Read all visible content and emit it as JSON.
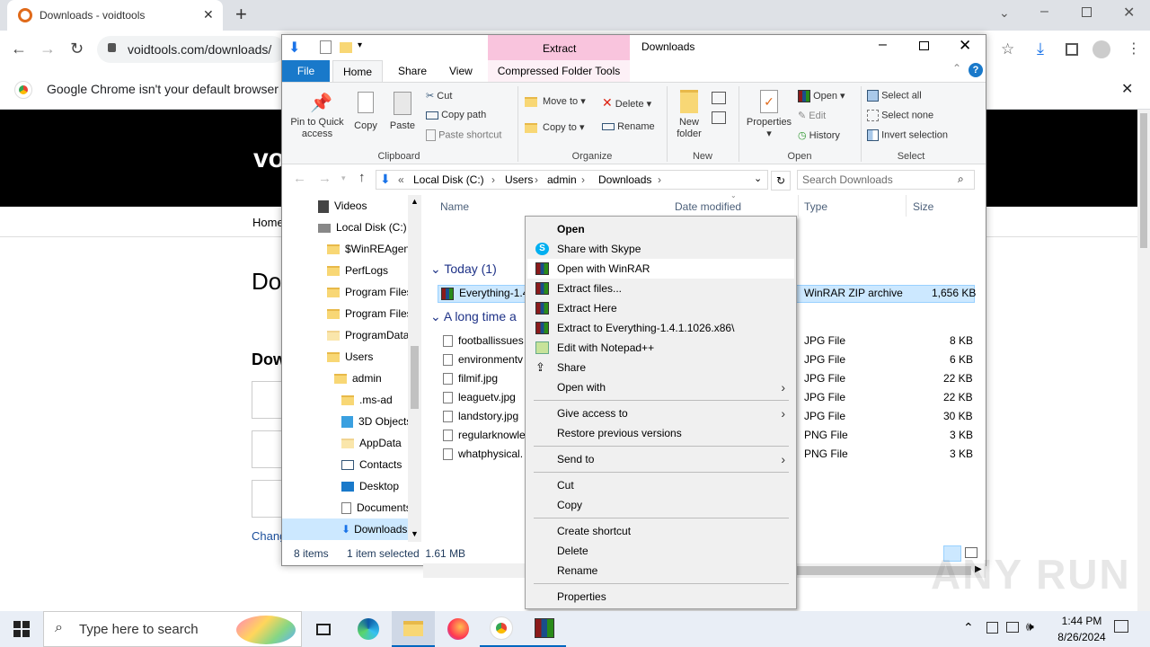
{
  "chrome": {
    "tab_title": "Downloads - voidtools",
    "new_tab": "+",
    "url": "voidtools.com/downloads/",
    "infobar_text": "Google Chrome isn't your default browser",
    "infobar_close": "✕"
  },
  "site": {
    "logo_partial": "vo",
    "nav_home": "Home",
    "heading_partial": "Do",
    "sub_heading_partial": "Dow",
    "link_partial": "Chang"
  },
  "explorer": {
    "title": "Downloads",
    "context_tab": "Extract",
    "context_group": "Compressed Folder Tools",
    "tabs": [
      "File",
      "Home",
      "Share",
      "View"
    ],
    "clipboard": {
      "pin": "Pin to Quick access",
      "copy": "Copy",
      "paste": "Paste",
      "cut": "Cut",
      "copy_path": "Copy path",
      "paste_shortcut": "Paste shortcut",
      "label": "Clipboard"
    },
    "organize": {
      "move_to": "Move to",
      "copy_to": "Copy to",
      "delete": "Delete",
      "rename": "Rename",
      "label": "Organize"
    },
    "new": {
      "new_folder": "New folder",
      "label": "New"
    },
    "open": {
      "properties": "Properties",
      "open": "Open",
      "edit": "Edit",
      "history": "History",
      "label": "Open"
    },
    "select": {
      "select_all": "Select all",
      "select_none": "Select none",
      "invert": "Invert selection",
      "label": "Select"
    },
    "address": {
      "crumbs": [
        "Local Disk (C:)",
        "Users",
        "admin",
        "Downloads"
      ],
      "search_placeholder": "Search Downloads"
    },
    "nav": [
      {
        "label": "Videos"
      },
      {
        "label": "Local Disk (C:)"
      },
      {
        "label": "$WinREAgent"
      },
      {
        "label": "PerfLogs"
      },
      {
        "label": "Program Files"
      },
      {
        "label": "Program Files"
      },
      {
        "label": "ProgramData"
      },
      {
        "label": "Users"
      },
      {
        "label": "admin"
      },
      {
        "label": ".ms-ad"
      },
      {
        "label": "3D Objects"
      },
      {
        "label": "AppData"
      },
      {
        "label": "Contacts"
      },
      {
        "label": "Desktop"
      },
      {
        "label": "Documents"
      },
      {
        "label": "Downloads"
      }
    ],
    "columns": {
      "name": "Name",
      "date": "Date modified",
      "type": "Type",
      "size": "Size"
    },
    "groups": {
      "today": "Today (1)",
      "long_ago": "A long time a"
    },
    "files": [
      {
        "name": "Everything-1.4",
        "type": "WinRAR ZIP archive",
        "size": "1,656 KB"
      },
      {
        "name": "footballissues",
        "type": "JPG File",
        "size": "8 KB"
      },
      {
        "name": "environmentv",
        "type": "JPG File",
        "size": "6 KB"
      },
      {
        "name": "filmif.jpg",
        "type": "JPG File",
        "size": "22 KB"
      },
      {
        "name": "leaguetv.jpg",
        "type": "JPG File",
        "size": "22 KB"
      },
      {
        "name": "landstory.jpg",
        "type": "JPG File",
        "size": "30 KB"
      },
      {
        "name": "regularknowle",
        "type": "PNG File",
        "size": "3 KB"
      },
      {
        "name": "whatphysical.",
        "type": "PNG File",
        "size": "3 KB"
      }
    ],
    "status": {
      "items": "8 items",
      "selected": "1 item selected  1.61 MB"
    }
  },
  "context_menu": {
    "open": "Open",
    "share_skype": "Share with Skype",
    "open_winrar": "Open with WinRAR",
    "extract_files": "Extract files...",
    "extract_here": "Extract Here",
    "extract_to": "Extract to Everything-1.4.1.1026.x86\\",
    "edit_npp": "Edit with Notepad++",
    "share": "Share",
    "open_with": "Open with",
    "give_access": "Give access to",
    "restore": "Restore previous versions",
    "send_to": "Send to",
    "cut": "Cut",
    "copy": "Copy",
    "create_shortcut": "Create shortcut",
    "delete": "Delete",
    "rename": "Rename",
    "properties": "Properties"
  },
  "taskbar": {
    "search_placeholder": "Type here to search",
    "time": "1:44 PM",
    "date": "8/26/2024"
  },
  "watermark": "ANY RUN"
}
